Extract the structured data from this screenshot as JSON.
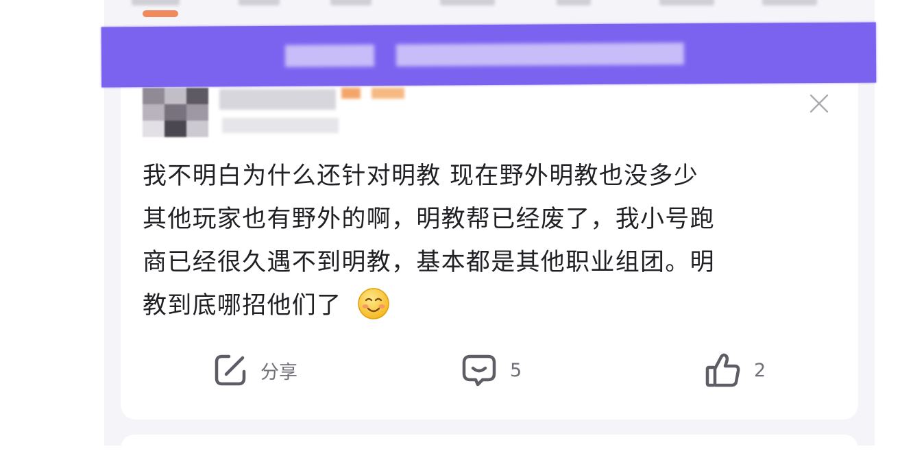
{
  "post": {
    "close_label": "×",
    "lines": [
      "我不明白为什么还针对明教  现在野外明教也没多少",
      "其他玩家也有野外的啊，明教帮已经废了，我小号跑",
      "商已经很久遇不到明教，基本都是其他职业组团。明",
      "教到底哪招他们了"
    ],
    "emoji": "smiling-face-icon"
  },
  "actions": {
    "share_label": "分享",
    "comment_count": "5",
    "like_count": "2"
  },
  "colors": {
    "banner": "#7b63f0",
    "tab_indicator": "#f08a5d",
    "feed_background": "#f5f4f8",
    "card_background": "#ffffff",
    "text": "#1f1f24",
    "icon": "#5d5d66"
  }
}
